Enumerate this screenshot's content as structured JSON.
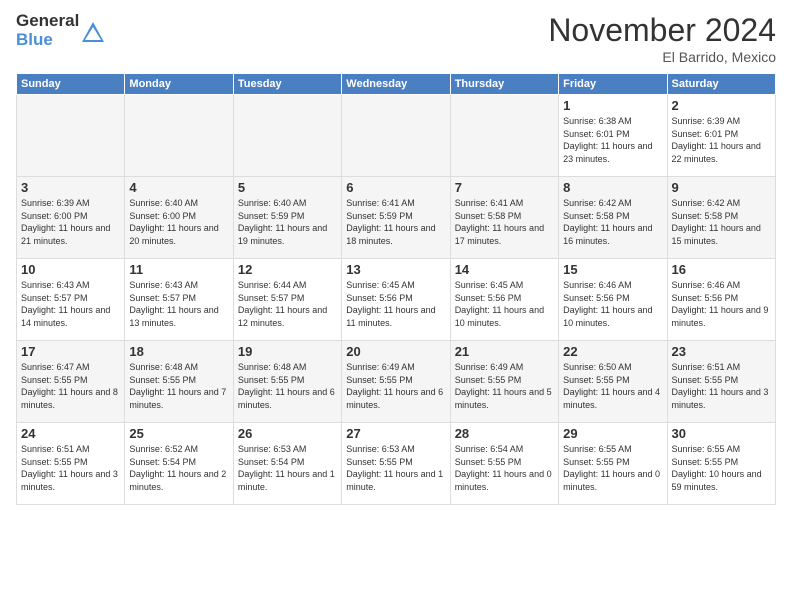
{
  "logo": {
    "general": "General",
    "blue": "Blue"
  },
  "title": "November 2024",
  "location": "El Barrido, Mexico",
  "days_header": [
    "Sunday",
    "Monday",
    "Tuesday",
    "Wednesday",
    "Thursday",
    "Friday",
    "Saturday"
  ],
  "weeks": [
    [
      {
        "day": "",
        "info": ""
      },
      {
        "day": "",
        "info": ""
      },
      {
        "day": "",
        "info": ""
      },
      {
        "day": "",
        "info": ""
      },
      {
        "day": "",
        "info": ""
      },
      {
        "day": "1",
        "info": "Sunrise: 6:38 AM\nSunset: 6:01 PM\nDaylight: 11 hours and 23 minutes."
      },
      {
        "day": "2",
        "info": "Sunrise: 6:39 AM\nSunset: 6:01 PM\nDaylight: 11 hours and 22 minutes."
      }
    ],
    [
      {
        "day": "3",
        "info": "Sunrise: 6:39 AM\nSunset: 6:00 PM\nDaylight: 11 hours and 21 minutes."
      },
      {
        "day": "4",
        "info": "Sunrise: 6:40 AM\nSunset: 6:00 PM\nDaylight: 11 hours and 20 minutes."
      },
      {
        "day": "5",
        "info": "Sunrise: 6:40 AM\nSunset: 5:59 PM\nDaylight: 11 hours and 19 minutes."
      },
      {
        "day": "6",
        "info": "Sunrise: 6:41 AM\nSunset: 5:59 PM\nDaylight: 11 hours and 18 minutes."
      },
      {
        "day": "7",
        "info": "Sunrise: 6:41 AM\nSunset: 5:58 PM\nDaylight: 11 hours and 17 minutes."
      },
      {
        "day": "8",
        "info": "Sunrise: 6:42 AM\nSunset: 5:58 PM\nDaylight: 11 hours and 16 minutes."
      },
      {
        "day": "9",
        "info": "Sunrise: 6:42 AM\nSunset: 5:58 PM\nDaylight: 11 hours and 15 minutes."
      }
    ],
    [
      {
        "day": "10",
        "info": "Sunrise: 6:43 AM\nSunset: 5:57 PM\nDaylight: 11 hours and 14 minutes."
      },
      {
        "day": "11",
        "info": "Sunrise: 6:43 AM\nSunset: 5:57 PM\nDaylight: 11 hours and 13 minutes."
      },
      {
        "day": "12",
        "info": "Sunrise: 6:44 AM\nSunset: 5:57 PM\nDaylight: 11 hours and 12 minutes."
      },
      {
        "day": "13",
        "info": "Sunrise: 6:45 AM\nSunset: 5:56 PM\nDaylight: 11 hours and 11 minutes."
      },
      {
        "day": "14",
        "info": "Sunrise: 6:45 AM\nSunset: 5:56 PM\nDaylight: 11 hours and 10 minutes."
      },
      {
        "day": "15",
        "info": "Sunrise: 6:46 AM\nSunset: 5:56 PM\nDaylight: 11 hours and 10 minutes."
      },
      {
        "day": "16",
        "info": "Sunrise: 6:46 AM\nSunset: 5:56 PM\nDaylight: 11 hours and 9 minutes."
      }
    ],
    [
      {
        "day": "17",
        "info": "Sunrise: 6:47 AM\nSunset: 5:55 PM\nDaylight: 11 hours and 8 minutes."
      },
      {
        "day": "18",
        "info": "Sunrise: 6:48 AM\nSunset: 5:55 PM\nDaylight: 11 hours and 7 minutes."
      },
      {
        "day": "19",
        "info": "Sunrise: 6:48 AM\nSunset: 5:55 PM\nDaylight: 11 hours and 6 minutes."
      },
      {
        "day": "20",
        "info": "Sunrise: 6:49 AM\nSunset: 5:55 PM\nDaylight: 11 hours and 6 minutes."
      },
      {
        "day": "21",
        "info": "Sunrise: 6:49 AM\nSunset: 5:55 PM\nDaylight: 11 hours and 5 minutes."
      },
      {
        "day": "22",
        "info": "Sunrise: 6:50 AM\nSunset: 5:55 PM\nDaylight: 11 hours and 4 minutes."
      },
      {
        "day": "23",
        "info": "Sunrise: 6:51 AM\nSunset: 5:55 PM\nDaylight: 11 hours and 3 minutes."
      }
    ],
    [
      {
        "day": "24",
        "info": "Sunrise: 6:51 AM\nSunset: 5:55 PM\nDaylight: 11 hours and 3 minutes."
      },
      {
        "day": "25",
        "info": "Sunrise: 6:52 AM\nSunset: 5:54 PM\nDaylight: 11 hours and 2 minutes."
      },
      {
        "day": "26",
        "info": "Sunrise: 6:53 AM\nSunset: 5:54 PM\nDaylight: 11 hours and 1 minute."
      },
      {
        "day": "27",
        "info": "Sunrise: 6:53 AM\nSunset: 5:55 PM\nDaylight: 11 hours and 1 minute."
      },
      {
        "day": "28",
        "info": "Sunrise: 6:54 AM\nSunset: 5:55 PM\nDaylight: 11 hours and 0 minutes."
      },
      {
        "day": "29",
        "info": "Sunrise: 6:55 AM\nSunset: 5:55 PM\nDaylight: 11 hours and 0 minutes."
      },
      {
        "day": "30",
        "info": "Sunrise: 6:55 AM\nSunset: 5:55 PM\nDaylight: 10 hours and 59 minutes."
      }
    ]
  ]
}
